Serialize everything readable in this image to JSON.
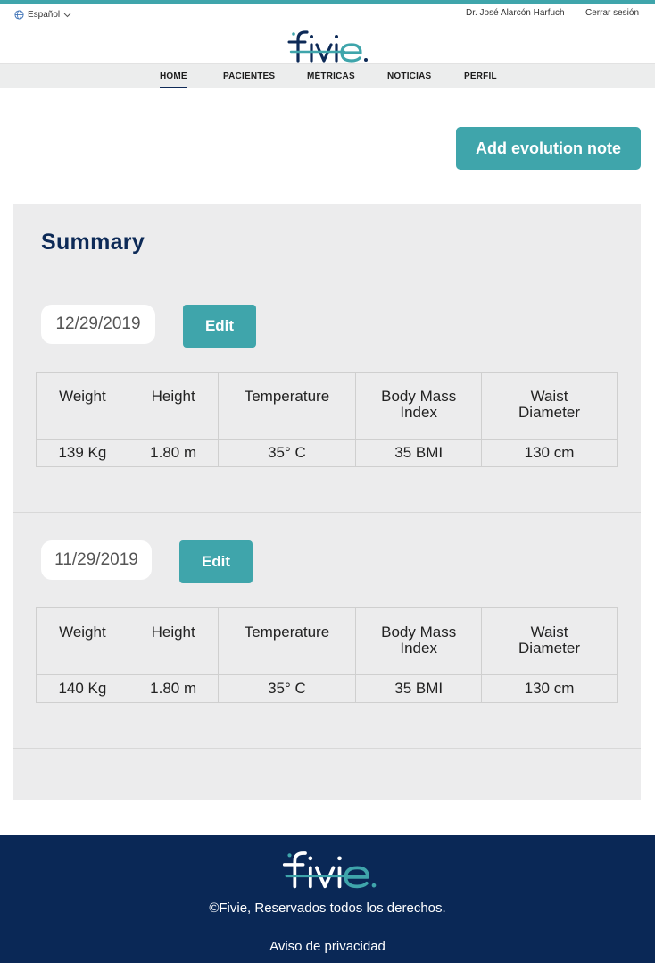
{
  "header": {
    "language": "Español",
    "user_name": "Dr. José Alarcón Harfuch",
    "logout": "Cerrar sesión",
    "logo_alt": "fivie"
  },
  "nav": {
    "items": [
      {
        "label": "HOME",
        "active": true
      },
      {
        "label": "PACIENTES",
        "active": false
      },
      {
        "label": "MÉTRICAS",
        "active": false
      },
      {
        "label": "NOTICIAS",
        "active": false
      },
      {
        "label": "PERFIL",
        "active": false
      }
    ]
  },
  "actions": {
    "add_evolution_note": "Add evolution note"
  },
  "summary": {
    "title": "Summary",
    "columns": [
      "Weight",
      "Height",
      "Temperature",
      "Body Mass Index",
      "Waist Diameter"
    ],
    "edit_label": "Edit",
    "entries": [
      {
        "date": "12/29/2019",
        "values": [
          "139 Kg",
          "1.80 m",
          "35° C",
          "35 BMI",
          "130 cm"
        ]
      },
      {
        "date": "11/29/2019",
        "values": [
          "140 Kg",
          "1.80 m",
          "35° C",
          "35 BMI",
          "130 cm"
        ]
      }
    ]
  },
  "footer": {
    "copyright": "©Fivie, Reservados todos los derechos.",
    "privacy": "Aviso de privacidad"
  },
  "colors": {
    "accent": "#3fa5ab",
    "navy": "#0a2856",
    "panel": "#ececed"
  }
}
